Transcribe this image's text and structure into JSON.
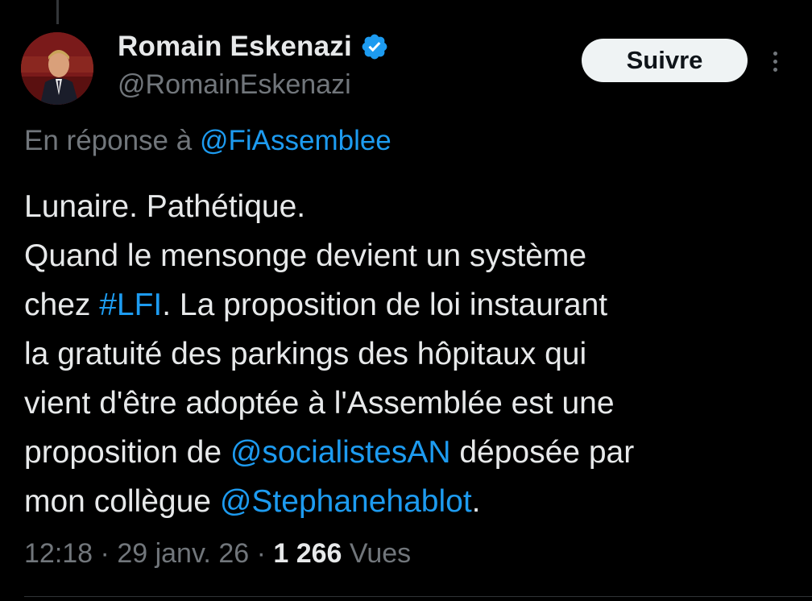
{
  "author": {
    "name": "Romain Eskenazi",
    "handle": "@RomainEskenazi",
    "avatar_icon": "profile-photo",
    "verified_icon": "verified-badge-icon"
  },
  "actions": {
    "follow_label": "Suivre",
    "more_icon": "more-options-icon"
  },
  "reply": {
    "prefix": "En réponse à",
    "mention": "@FiAssemblee"
  },
  "tweet": {
    "lines": [
      {
        "segments": [
          {
            "text": "Lunaire. Pathétique."
          }
        ]
      },
      {
        "segments": [
          {
            "text": "Quand le mensonge devient un système"
          }
        ]
      },
      {
        "segments": [
          {
            "text": "chez "
          },
          {
            "text": "#LFI",
            "link": true
          },
          {
            "text": ". La proposition de loi instaurant"
          }
        ]
      },
      {
        "segments": [
          {
            "text": "la gratuité des parkings des hôpitaux qui"
          }
        ]
      },
      {
        "segments": [
          {
            "text": "vient d'être adoptée à l'Assemblée est une"
          }
        ]
      },
      {
        "segments": [
          {
            "text": "proposition de "
          },
          {
            "text": "@socialistesAN",
            "link": true
          },
          {
            "text": " déposée par"
          }
        ]
      },
      {
        "segments": [
          {
            "text": "mon collègue "
          },
          {
            "text": "@Stephanehablot",
            "link": true
          },
          {
            "text": "."
          }
        ]
      }
    ]
  },
  "meta": {
    "time": "12:18",
    "separator": " · ",
    "date": "29 janv. 26",
    "views_count": "1 266",
    "views_label": "Vues"
  },
  "colors": {
    "background": "#000000",
    "text": "#e7e9ea",
    "secondary": "#71767b",
    "link": "#1d9bf0",
    "verified": "#1d9bf0",
    "follow_bg": "#eff3f4"
  }
}
